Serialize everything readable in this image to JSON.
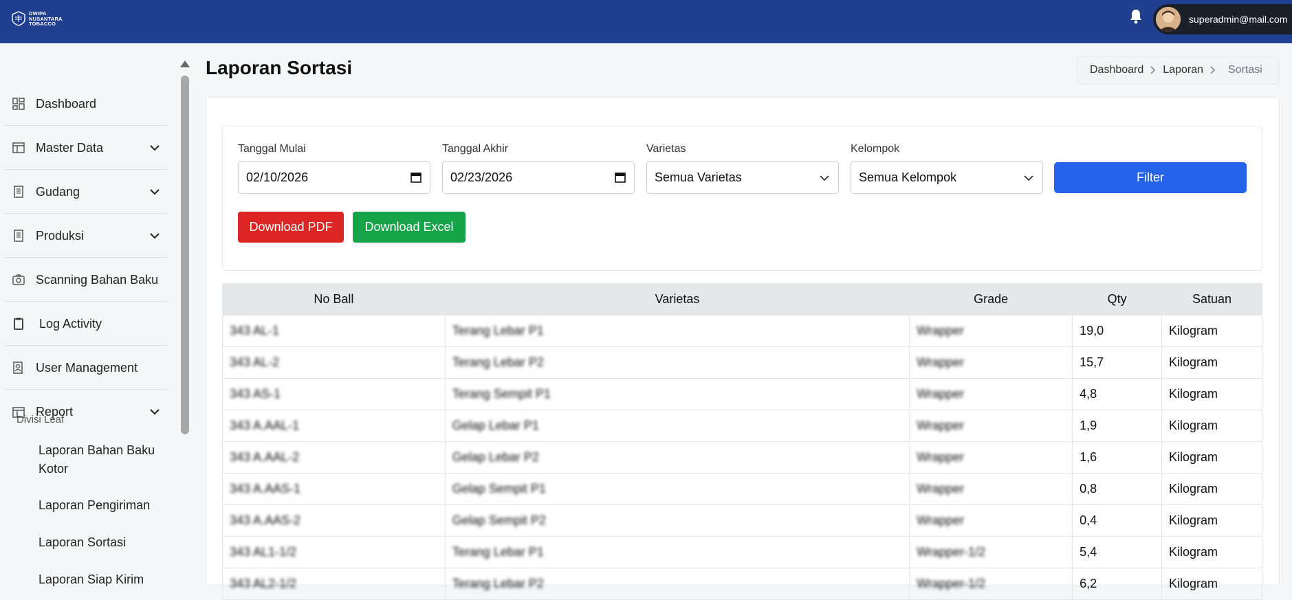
{
  "brand": {
    "line1": "DWIPA",
    "line2": "NUSANTARA",
    "line3": "TOBACCO"
  },
  "user": {
    "email": "superadmin@mail.com"
  },
  "sidebar": {
    "items": [
      {
        "label": "Dashboard",
        "icon": "grid-icon"
      },
      {
        "label": "Master Data",
        "icon": "table-icon"
      },
      {
        "label": "Gudang",
        "icon": "document-icon"
      },
      {
        "label": "Produksi",
        "icon": "document-icon"
      },
      {
        "label": "Scanning Bahan Baku",
        "icon": "camera-icon"
      },
      {
        "label": "Log Activity",
        "icon": "clipboard-icon"
      },
      {
        "label": "User Management",
        "icon": "user-icon"
      },
      {
        "label": "Report",
        "icon": "table-icon"
      }
    ],
    "section_title": "Divisi Leaf",
    "sub_items": [
      "Laporan Bahan Baku Kotor",
      "Laporan Pengiriman",
      "Laporan Sortasi",
      "Laporan Siap Kirim"
    ]
  },
  "page": {
    "title": "Laporan Sortasi"
  },
  "breadcrumb": {
    "items": [
      "Dashboard",
      "Laporan"
    ],
    "current": "Sortasi"
  },
  "filters": {
    "start_label": "Tanggal Mulai",
    "start_value": "02/10/2026",
    "end_label": "Tanggal Akhir",
    "end_value": "02/23/2026",
    "varietas_label": "Varietas",
    "varietas_value": "Semua Varietas",
    "kelompok_label": "Kelompok",
    "kelompok_value": "Semua Kelompok",
    "filter_button": "Filter",
    "pdf_button": "Download PDF",
    "excel_button": "Download Excel"
  },
  "table": {
    "headers": [
      "No Ball",
      "Varietas",
      "Grade",
      "Qty",
      "Satuan"
    ],
    "rows": [
      [
        "343 AL-1",
        "Terang Lebar P1",
        "Wrapper",
        "19,0",
        "Kilogram"
      ],
      [
        "343 AL-2",
        "Terang Lebar P2",
        "Wrapper",
        "15,7",
        "Kilogram"
      ],
      [
        "343 AS-1",
        "Terang Sempit P1",
        "Wrapper",
        "4,8",
        "Kilogram"
      ],
      [
        "343 A.AAL-1",
        "Gelap Lebar P1",
        "Wrapper",
        "1,9",
        "Kilogram"
      ],
      [
        "343 A.AAL-2",
        "Gelap Lebar P2",
        "Wrapper",
        "1,6",
        "Kilogram"
      ],
      [
        "343 A.AAS-1",
        "Gelap Sempit P1",
        "Wrapper",
        "0,8",
        "Kilogram"
      ],
      [
        "343 A.AAS-2",
        "Gelap Sempit P2",
        "Wrapper",
        "0,4",
        "Kilogram"
      ],
      [
        "343 AL1-1/2",
        "Terang Lebar P1",
        "Wrapper-1/2",
        "5,4",
        "Kilogram"
      ],
      [
        "343 AL2-1/2",
        "Terang Lebar P2",
        "Wrapper-1/2",
        "6,2",
        "Kilogram"
      ]
    ]
  }
}
